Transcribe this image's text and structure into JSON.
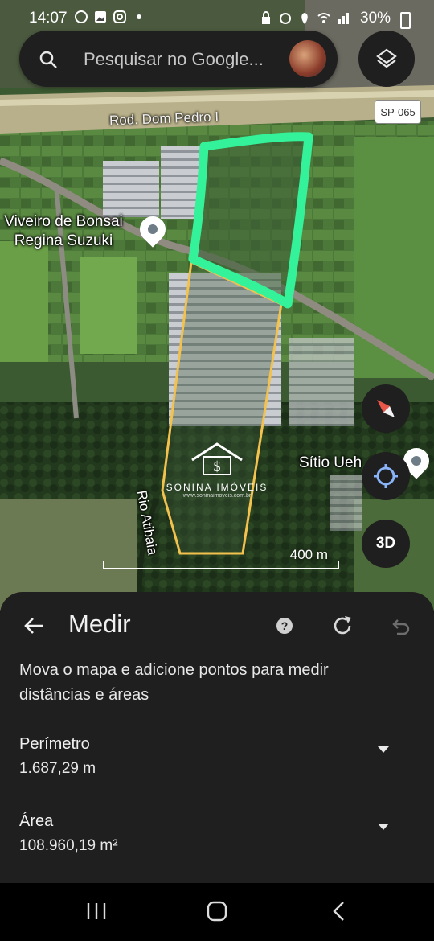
{
  "status_bar": {
    "time": "14:07",
    "battery": "30%",
    "left_icons": [
      "whatsapp-icon",
      "gallery-icon",
      "instagram-icon",
      "dot-icon"
    ],
    "right_icons": [
      "lock-icon",
      "alarm-icon",
      "location-icon",
      "wifi-icon",
      "signal-icon"
    ]
  },
  "search": {
    "placeholder": "Pesquisar no Google..."
  },
  "map": {
    "road_name": "Rod. Dom Pedro I",
    "highway_shield": "SP-065",
    "places": [
      {
        "name_line1": "Viveiro de Bonsai",
        "name_line2": "Regina Suzuki"
      },
      {
        "name_line1": "Sítio Ueh",
        "name_line2": ""
      }
    ],
    "river_label": "Rio Atibaia",
    "scale_label": "400 m",
    "watermark": {
      "brand": "SONINA IMÓVEIS",
      "site": "www.soninaimoveis.com.br"
    },
    "buttons": {
      "three_d": "3D"
    },
    "colors": {
      "outline_green": "#34f29a",
      "outline_yellow": "#f2c14e"
    }
  },
  "sheet": {
    "title": "Medir",
    "hint": "Mova o mapa e adicione pontos para medir distâncias e áreas",
    "perimeter": {
      "label": "Perímetro",
      "value": "1.687,29 m"
    },
    "area": {
      "label": "Área",
      "value": "108.960,19 m²"
    }
  }
}
